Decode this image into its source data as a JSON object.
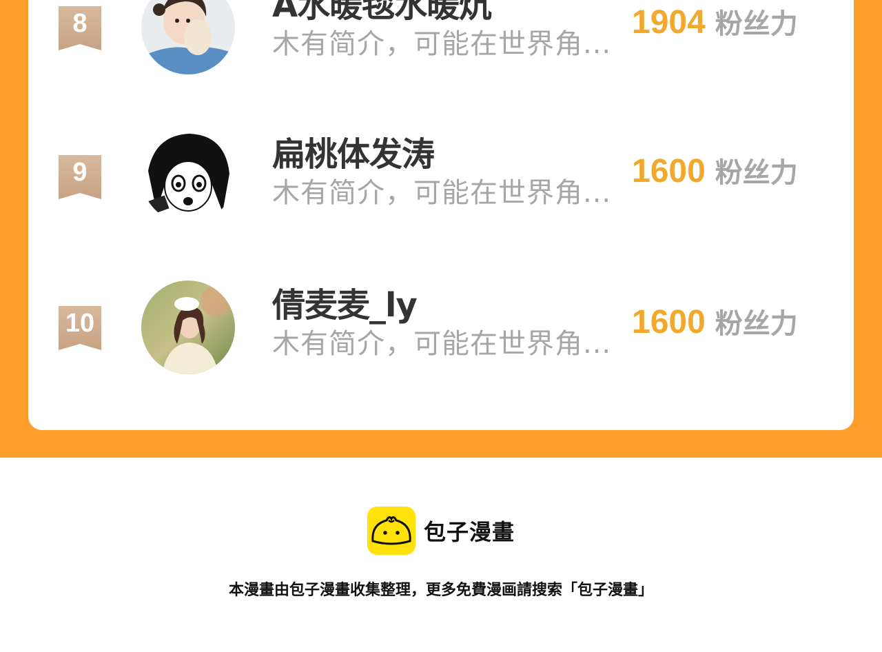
{
  "ranking": {
    "fans_unit": "粉丝力",
    "entries": [
      {
        "rank": "8",
        "name": "A水暖毯水暖炕",
        "bio": "木有简介，可能在世界角...",
        "fans": "1904"
      },
      {
        "rank": "9",
        "name": "扁桃体发涛",
        "bio": "木有简介，可能在世界角...",
        "fans": "1600"
      },
      {
        "rank": "10",
        "name": "倩麦麦_ly",
        "bio": "木有简介，可能在世界角...",
        "fans": "1600"
      }
    ]
  },
  "footer": {
    "brand": "包子漫畫",
    "note": "本漫畫由包子漫畫收集整理，更多免費漫画請搜索「包子漫畫」"
  },
  "colors": {
    "panel": "#FF9E2B",
    "fans_number": "#F2A82C",
    "rank_ribbon": "#C8A283",
    "logo_bg": "#FFE20A"
  },
  "icons": {
    "rank": "rank-ribbon-icon",
    "logo": "bun-logo-icon"
  }
}
